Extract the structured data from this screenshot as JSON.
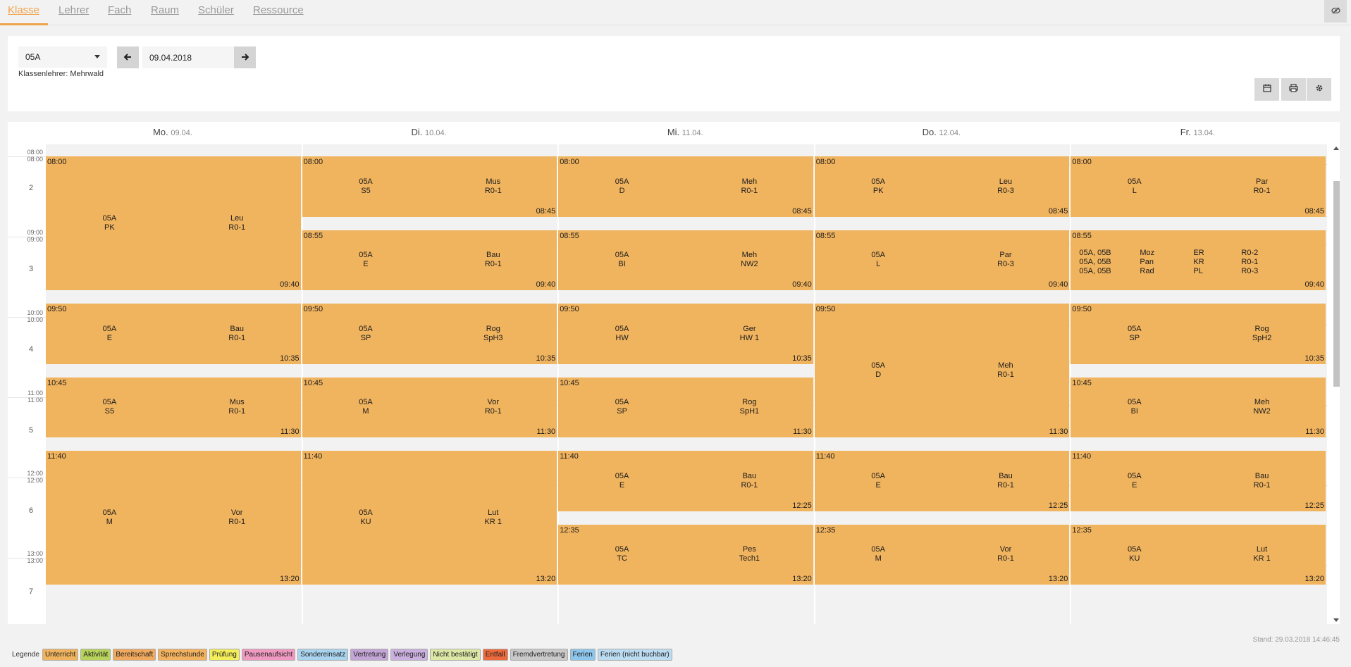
{
  "tabs": [
    {
      "label": "Klasse",
      "active": true
    },
    {
      "label": "Lehrer",
      "active": false
    },
    {
      "label": "Fach",
      "active": false
    },
    {
      "label": "Raum",
      "active": false
    },
    {
      "label": "Schüler",
      "active": false
    },
    {
      "label": "Ressource",
      "active": false
    }
  ],
  "controls": {
    "class_value": "05A",
    "date_value": "09.04.2018",
    "class_teacher": "Klassenlehrer: Mehrwald"
  },
  "icons": {
    "eye": "eye-slash-icon",
    "prev": "arrow-left-icon",
    "next": "arrow-right-icon",
    "calendar": "calendar-icon",
    "print": "print-icon",
    "settings": "gear-icon"
  },
  "days": [
    {
      "name": "Mo.",
      "date": "09.04."
    },
    {
      "name": "Di.",
      "date": "10.04."
    },
    {
      "name": "Mi.",
      "date": "11.04."
    },
    {
      "name": "Do.",
      "date": "12.04."
    },
    {
      "name": "Fr.",
      "date": "13.04."
    }
  ],
  "time_labels": [
    "08:00",
    "09:00",
    "10:00",
    "11:00",
    "12:00",
    "13:00"
  ],
  "periods": [
    "2",
    "3",
    "4",
    "5",
    "6",
    "7"
  ],
  "lessons": [
    {
      "day": 0,
      "start": "08:00",
      "end": "09:40",
      "classes": "05A",
      "subject": "PK",
      "teacher": "Leu",
      "room": "R0-1"
    },
    {
      "day": 0,
      "start": "09:50",
      "end": "10:35",
      "classes": "05A",
      "subject": "E",
      "teacher": "Bau",
      "room": "R0-1"
    },
    {
      "day": 0,
      "start": "10:45",
      "end": "11:30",
      "classes": "05A",
      "subject": "S5",
      "teacher": "Mus",
      "room": "R0-1"
    },
    {
      "day": 0,
      "start": "11:40",
      "end": "13:20",
      "classes": "05A",
      "subject": "M",
      "teacher": "Vor",
      "room": "R0-1"
    },
    {
      "day": 1,
      "start": "08:00",
      "end": "08:45",
      "classes": "05A",
      "subject": "S5",
      "teacher": "Mus",
      "room": "R0-1"
    },
    {
      "day": 1,
      "start": "08:55",
      "end": "09:40",
      "classes": "05A",
      "subject": "E",
      "teacher": "Bau",
      "room": "R0-1"
    },
    {
      "day": 1,
      "start": "09:50",
      "end": "10:35",
      "classes": "05A",
      "subject": "SP",
      "teacher": "Rog",
      "room": "SpH3"
    },
    {
      "day": 1,
      "start": "10:45",
      "end": "11:30",
      "classes": "05A",
      "subject": "M",
      "teacher": "Vor",
      "room": "R0-1"
    },
    {
      "day": 1,
      "start": "11:40",
      "end": "13:20",
      "classes": "05A",
      "subject": "KU",
      "teacher": "Lut",
      "room": "KR 1"
    },
    {
      "day": 2,
      "start": "08:00",
      "end": "08:45",
      "classes": "05A",
      "subject": "D",
      "teacher": "Meh",
      "room": "R0-1"
    },
    {
      "day": 2,
      "start": "08:55",
      "end": "09:40",
      "classes": "05A",
      "subject": "BI",
      "teacher": "Meh",
      "room": "NW2"
    },
    {
      "day": 2,
      "start": "09:50",
      "end": "10:35",
      "classes": "05A",
      "subject": "HW",
      "teacher": "Ger",
      "room": "HW 1"
    },
    {
      "day": 2,
      "start": "10:45",
      "end": "11:30",
      "classes": "05A",
      "subject": "SP",
      "teacher": "Rog",
      "room": "SpH1"
    },
    {
      "day": 2,
      "start": "11:40",
      "end": "12:25",
      "classes": "05A",
      "subject": "E",
      "teacher": "Bau",
      "room": "R0-1"
    },
    {
      "day": 2,
      "start": "12:35",
      "end": "13:20",
      "classes": "05A",
      "subject": "TC",
      "teacher": "Pes",
      "room": "Tech1"
    },
    {
      "day": 3,
      "start": "08:00",
      "end": "08:45",
      "classes": "05A",
      "subject": "PK",
      "teacher": "Leu",
      "room": "R0-3"
    },
    {
      "day": 3,
      "start": "08:55",
      "end": "09:40",
      "classes": "05A",
      "subject": "L",
      "teacher": "Par",
      "room": "R0-3"
    },
    {
      "day": 3,
      "start": "09:50",
      "end": "11:30",
      "classes": "05A",
      "subject": "D",
      "teacher": "Meh",
      "room": "R0-1"
    },
    {
      "day": 3,
      "start": "11:40",
      "end": "12:25",
      "classes": "05A",
      "subject": "E",
      "teacher": "Bau",
      "room": "R0-1"
    },
    {
      "day": 3,
      "start": "12:35",
      "end": "13:20",
      "classes": "05A",
      "subject": "M",
      "teacher": "Vor",
      "room": "R0-1"
    },
    {
      "day": 4,
      "start": "08:00",
      "end": "08:45",
      "classes": "05A",
      "subject": "L",
      "teacher": "Par",
      "room": "R0-1"
    },
    {
      "day": 4,
      "start": "08:55",
      "end": "09:40",
      "multi": [
        [
          "05A, 05B",
          "Moz",
          "ER",
          "R0-2"
        ],
        [
          "05A, 05B",
          "Pan",
          "KR",
          "R0-1"
        ],
        [
          "05A, 05B",
          "Rad",
          "PL",
          "R0-3"
        ]
      ]
    },
    {
      "day": 4,
      "start": "09:50",
      "end": "10:35",
      "classes": "05A",
      "subject": "SP",
      "teacher": "Rog",
      "room": "SpH2"
    },
    {
      "day": 4,
      "start": "10:45",
      "end": "11:30",
      "classes": "05A",
      "subject": "BI",
      "teacher": "Meh",
      "room": "NW2"
    },
    {
      "day": 4,
      "start": "11:40",
      "end": "12:25",
      "classes": "05A",
      "subject": "E",
      "teacher": "Bau",
      "room": "R0-1"
    },
    {
      "day": 4,
      "start": "12:35",
      "end": "13:20",
      "classes": "05A",
      "subject": "KU",
      "teacher": "Lut",
      "room": "KR 1"
    }
  ],
  "status": "Stand: 29.03.2018 14:46:45",
  "legend_title": "Legende",
  "legend": [
    {
      "label": "Unterricht",
      "color": "#f0b35e"
    },
    {
      "label": "Aktivität",
      "color": "#b7d35b"
    },
    {
      "label": "Bereitschaft",
      "color": "#f1a95d"
    },
    {
      "label": "Sprechstunde",
      "color": "#f3b25e"
    },
    {
      "label": "Prüfung",
      "color": "#f4ee5a"
    },
    {
      "label": "Pausenaufsicht",
      "color": "#f19ac1"
    },
    {
      "label": "Sondereinsatz",
      "color": "#a9d3ee"
    },
    {
      "label": "Vertretung",
      "color": "#c3a6d6"
    },
    {
      "label": "Verlegung",
      "color": "#c9b0de"
    },
    {
      "label": "Nicht bestätigt",
      "color": "#dde8a6"
    },
    {
      "label": "Entfall",
      "color": "#ee6a3c"
    },
    {
      "label": "Fremdvertretung",
      "color": "#c9c9c9"
    },
    {
      "label": "Ferien",
      "color": "#8ec7ee"
    },
    {
      "label": "Ferien (nicht buchbar)",
      "color": "#bcdcf2"
    }
  ]
}
